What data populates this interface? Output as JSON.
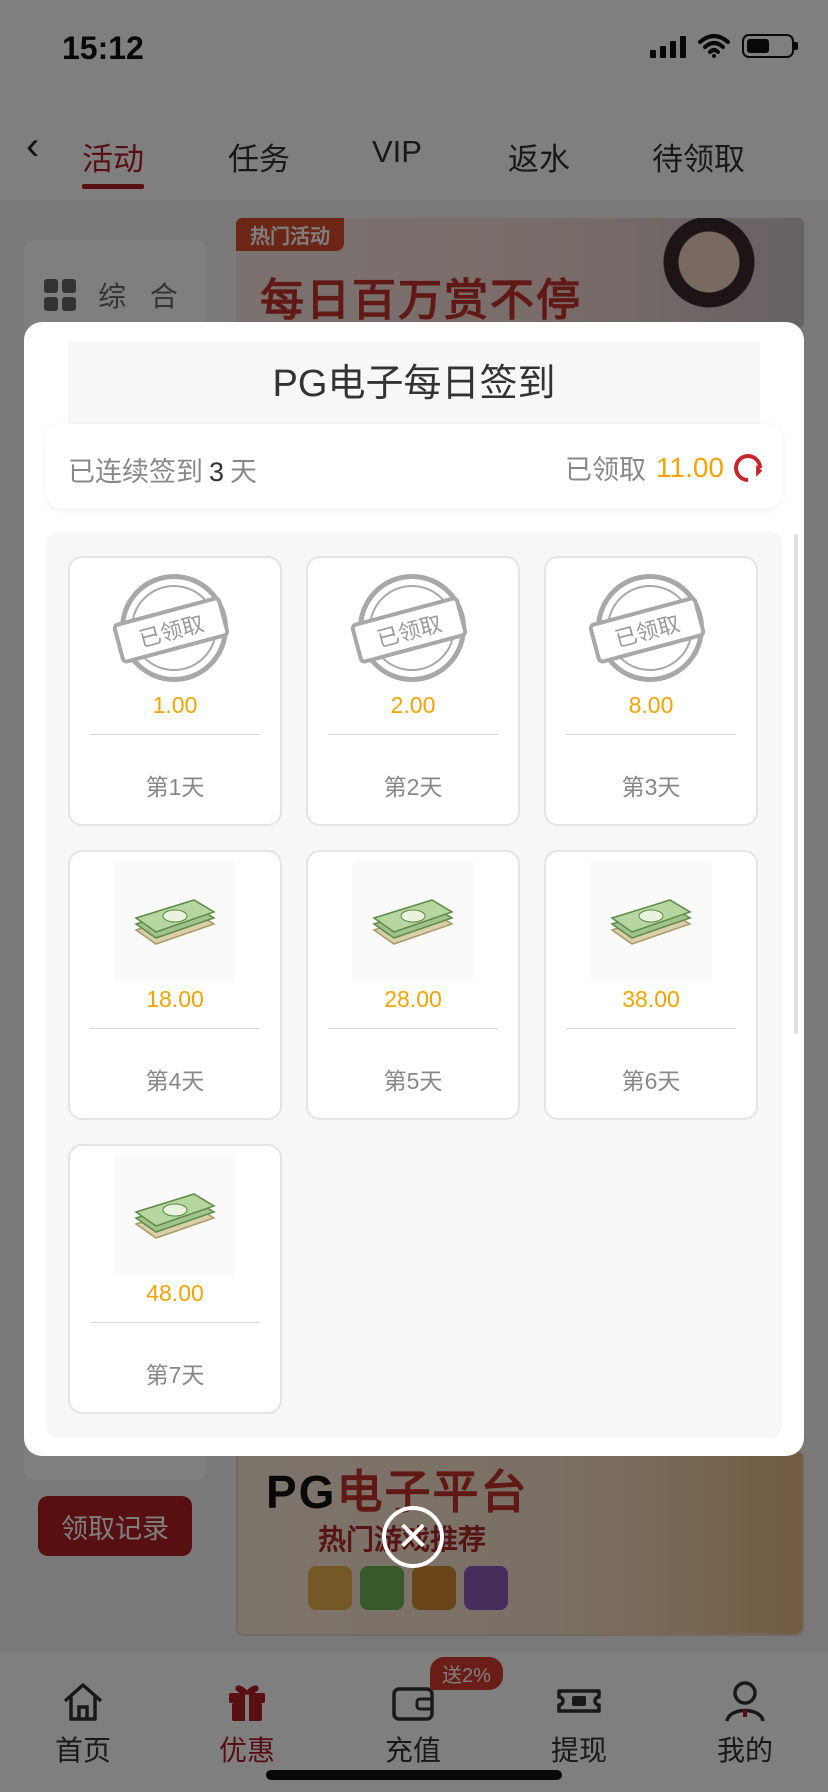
{
  "status": {
    "time": "15:12"
  },
  "tabs": [
    {
      "label": "活动",
      "active": true
    },
    {
      "label": "任务",
      "active": false
    },
    {
      "label": "VIP",
      "active": false
    },
    {
      "label": "返水",
      "active": false
    },
    {
      "label": "待领取",
      "active": false
    }
  ],
  "sidebar": {
    "item_label": "综 合",
    "record_button": "领取记录"
  },
  "banner_top": {
    "tag": "热门活动",
    "headline": "每日百万赏不停"
  },
  "banner_bottom": {
    "title_pg": "PG",
    "title_rest": "电子平台",
    "subtitle": "热门游戏推荐"
  },
  "modal": {
    "title": "PG电子每日签到",
    "streak_prefix": "已连续签到",
    "streak_days": "3",
    "streak_suffix": "天",
    "claimed_label": "已领取",
    "claimed_amount": "11.00",
    "stamp_text": "已领取",
    "days": [
      {
        "amount": "1.00",
        "label": "第1天",
        "claimed": true
      },
      {
        "amount": "2.00",
        "label": "第2天",
        "claimed": true
      },
      {
        "amount": "8.00",
        "label": "第3天",
        "claimed": true
      },
      {
        "amount": "18.00",
        "label": "第4天",
        "claimed": false
      },
      {
        "amount": "28.00",
        "label": "第5天",
        "claimed": false
      },
      {
        "amount": "38.00",
        "label": "第6天",
        "claimed": false
      },
      {
        "amount": "48.00",
        "label": "第7天",
        "claimed": false
      }
    ]
  },
  "bottom_nav": {
    "items": [
      {
        "label": "首页",
        "icon": "home-icon",
        "active": false
      },
      {
        "label": "优惠",
        "icon": "gift-icon",
        "active": true
      },
      {
        "label": "充值",
        "icon": "wallet-icon",
        "active": false
      },
      {
        "label": "提现",
        "icon": "withdraw-icon",
        "active": false
      },
      {
        "label": "我的",
        "icon": "profile-icon",
        "active": false
      }
    ],
    "promo_badge": "送2%"
  },
  "colors": {
    "brand": "#b01f24",
    "amount": "#f5a300"
  }
}
